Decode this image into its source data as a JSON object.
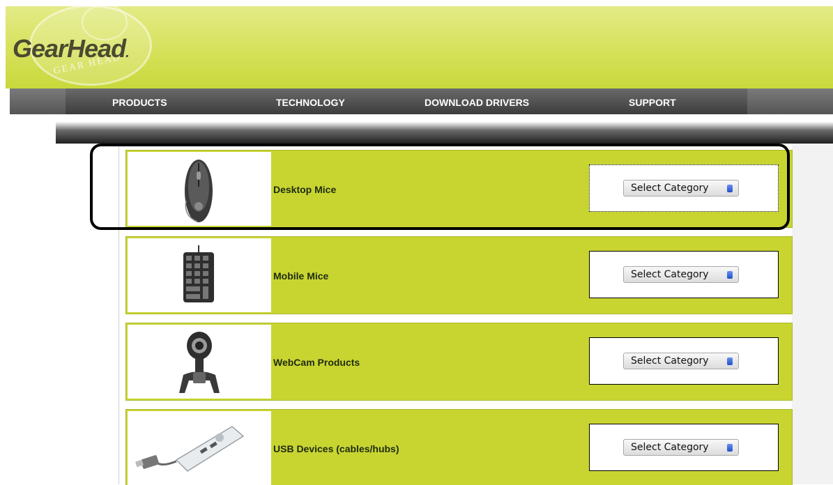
{
  "brand": {
    "name": "GearHead",
    "dot": ".",
    "sub_text": "GEAR HEAD"
  },
  "nav": {
    "items": [
      {
        "label": "PRODUCTS"
      },
      {
        "label": "TECHNOLOGY"
      },
      {
        "label": "DOWNLOAD DRIVERS"
      },
      {
        "label": "SUPPORT"
      }
    ]
  },
  "colors": {
    "accent": "#c8d531",
    "header": "#d6e15a",
    "nav": "#4a4a4a"
  },
  "categories": [
    {
      "label": "Desktop Mice",
      "select_label": "Select Category",
      "icon": "mouse-icon",
      "highlighted": true
    },
    {
      "label": "Mobile Mice",
      "select_label": "Select Category",
      "icon": "numeric-keypad-icon",
      "highlighted": false
    },
    {
      "label": "WebCam Products",
      "select_label": "Select Category",
      "icon": "webcam-icon",
      "highlighted": false
    },
    {
      "label": "USB Devices (cables/hubs)",
      "select_label": "Select Category",
      "icon": "usb-hub-icon",
      "highlighted": false
    }
  ]
}
